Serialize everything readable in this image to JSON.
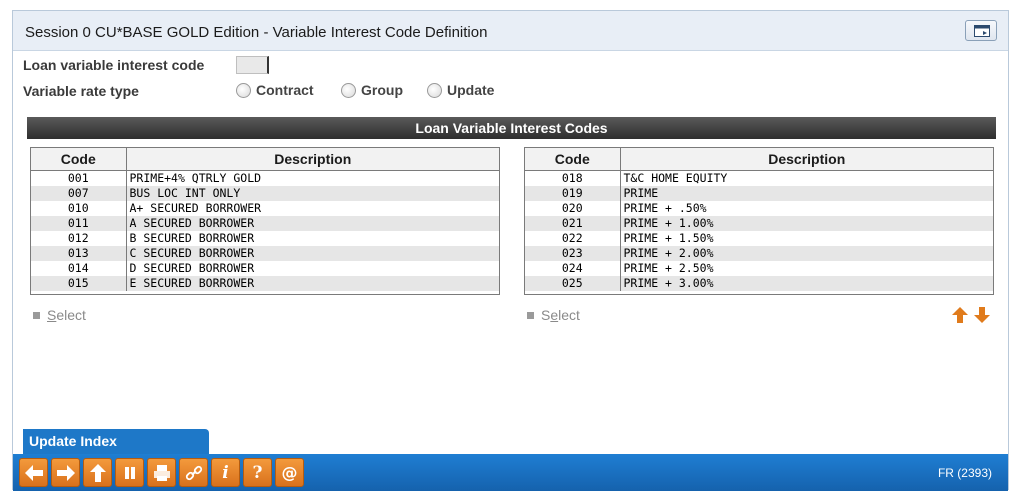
{
  "window": {
    "title": "Session 0 CU*BASE GOLD Edition - Variable Interest Code Definition"
  },
  "form": {
    "code_label": "Loan variable interest code",
    "code_value": "",
    "rate_type_label": "Variable rate type",
    "rate_types": [
      {
        "label": "Contract",
        "selected": false
      },
      {
        "label": "Group",
        "selected": false
      },
      {
        "label": "Update",
        "selected": false
      }
    ]
  },
  "section": {
    "title": "Loan Variable Interest Codes"
  },
  "left_grid": {
    "headers": {
      "code": "Code",
      "description": "Description"
    },
    "rows": [
      {
        "code": "001",
        "description": "PRIME+4% QTRLY GOLD"
      },
      {
        "code": "007",
        "description": "BUS LOC INT ONLY"
      },
      {
        "code": "010",
        "description": "A+ SECURED BORROWER"
      },
      {
        "code": "011",
        "description": "A SECURED BORROWER"
      },
      {
        "code": "012",
        "description": "B SECURED BORROWER"
      },
      {
        "code": "013",
        "description": "C SECURED BORROWER"
      },
      {
        "code": "014",
        "description": "D SECURED BORROWER"
      },
      {
        "code": "015",
        "description": "E SECURED BORROWER"
      }
    ],
    "select_label_pre": "",
    "select_label_key": "S",
    "select_label_post": "elect"
  },
  "right_grid": {
    "headers": {
      "code": "Code",
      "description": "Description"
    },
    "rows": [
      {
        "code": "018",
        "description": "T&C HOME EQUITY"
      },
      {
        "code": "019",
        "description": "PRIME"
      },
      {
        "code": "020",
        "description": "PRIME + .50%"
      },
      {
        "code": "021",
        "description": "PRIME + 1.00%"
      },
      {
        "code": "022",
        "description": "PRIME + 1.50%"
      },
      {
        "code": "023",
        "description": "PRIME + 2.00%"
      },
      {
        "code": "024",
        "description": "PRIME + 2.50%"
      },
      {
        "code": "025",
        "description": "PRIME + 3.00%"
      }
    ],
    "select_label_pre": "S",
    "select_label_key": "e",
    "select_label_post": "lect"
  },
  "footer": {
    "update_index_label": "Update Index",
    "screen_id": "FR (2393)",
    "tools": [
      "back-icon",
      "forward-icon",
      "up-icon",
      "pause-icon",
      "print-icon",
      "link-icon",
      "info-icon",
      "help-icon",
      "at-icon"
    ]
  },
  "colors": {
    "accent_blue": "#1e78c8",
    "tool_orange": "#e8832a",
    "section_bar": "#3a3a3a"
  }
}
